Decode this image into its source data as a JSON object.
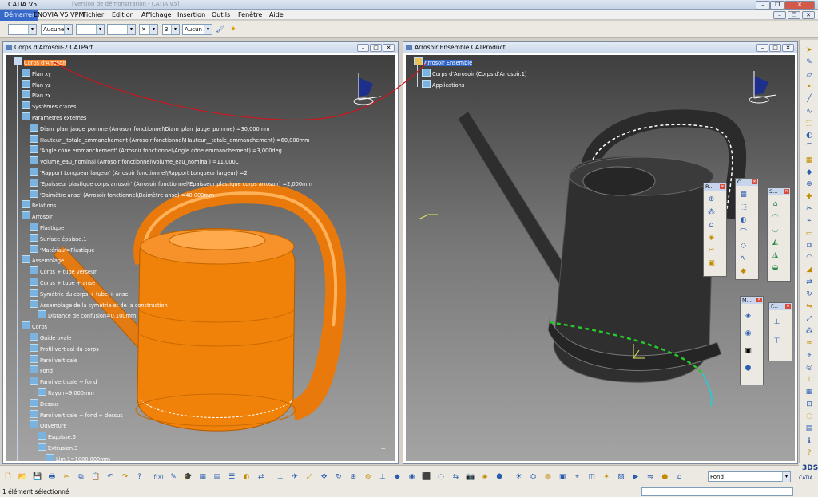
{
  "app_title": "CATIA V5",
  "title_ghost": "[Version de démonstration - CATIA V5]",
  "menu": {
    "start": "Démarrer",
    "items": [
      "ENOVIA V5 VPM",
      "Fichier",
      "Edition",
      "Affichage",
      "Insertion",
      "Outils",
      "Fenêtre",
      "Aide"
    ]
  },
  "toolbar": {
    "color_value": "",
    "transparency_value": "Aucune",
    "layer_value": "3",
    "layer_filter_value": "Aucun"
  },
  "window_left": {
    "title": "Corps d'Arrosoir-2.CATPart",
    "tree": [
      {
        "label": "Corps d'Arrosoir",
        "level": 0,
        "selected": true
      },
      {
        "label": "Plan xy",
        "level": 1
      },
      {
        "label": "Plan yz",
        "level": 1
      },
      {
        "label": "Plan zx",
        "level": 1
      },
      {
        "label": "Systèmes d'axes",
        "level": 1
      },
      {
        "label": "Paramètres externes",
        "level": 1
      },
      {
        "label": "Diam_plan_jauge_pomme (Arrosoir fonctionnel\\Diam_plan_jauge_pomme) =30,000mm",
        "level": 2
      },
      {
        "label": "Hauteur__totale_emmanchement (Arrosoir fonctionnel\\Hauteur__totale_emmanchement) =60,000mm",
        "level": 2
      },
      {
        "label": "'Angle cône emmanchement' (Arrosoir fonctionnel\\Angle cône emmanchement) =3,000deg",
        "level": 2
      },
      {
        "label": "Volume_eau_nominal (Arrosoir fonctionnel\\Volume_eau_nominal) =11,000L",
        "level": 2
      },
      {
        "label": "'Rapport Longueur largeur' (Arrosoir fonctionnel\\Rapport Longueur largeur) =2",
        "level": 2
      },
      {
        "label": "'Epaisseur plastique corps arrosoir' (Arrosoir fonctionnel\\Epaisseur plastique corps arrosoir) =2,000mm",
        "level": 2
      },
      {
        "label": "'Daimètre anse' (Arrosoir fonctionnel\\Daimètre anse) =40,000mm",
        "level": 2
      },
      {
        "label": "Relations",
        "level": 1
      },
      {
        "label": "Arrosoir",
        "level": 1
      },
      {
        "label": "Plastique",
        "level": 2
      },
      {
        "label": "Surface épaisse.1",
        "level": 2
      },
      {
        "label": "'Matériau'=Plastique",
        "level": 2
      },
      {
        "label": "Assemblage",
        "level": 1
      },
      {
        "label": "Corps + tube verseur",
        "level": 2
      },
      {
        "label": "Corps + tube + anse",
        "level": 2
      },
      {
        "label": "Symétrie du corps + tube + anse",
        "level": 2
      },
      {
        "label": "Assemblage de la symétrie et de la construction",
        "level": 2
      },
      {
        "label": "Distance de confusion=0,100mm",
        "level": 3
      },
      {
        "label": "Corps",
        "level": 1
      },
      {
        "label": "Guide ovale",
        "level": 2
      },
      {
        "label": "Profil vertical du corps",
        "level": 2
      },
      {
        "label": "Paroi verticale",
        "level": 2
      },
      {
        "label": "Fond",
        "level": 2
      },
      {
        "label": "Paroi verticale + fond",
        "level": 2
      },
      {
        "label": "Rayon=9,000mm",
        "level": 3
      },
      {
        "label": "Dessus",
        "level": 2
      },
      {
        "label": "Paroi verticale + fond + dessus",
        "level": 2
      },
      {
        "label": "Ouverture",
        "level": 2
      },
      {
        "label": "Esquisse.5",
        "level": 3
      },
      {
        "label": "Extrusion.3",
        "level": 3
      },
      {
        "label": "Lim 1=1000,000mm",
        "level": 4
      }
    ]
  },
  "window_right": {
    "title": "Arrosoir Ensemble.CATProduct",
    "tree": [
      {
        "label": "Arrosoir Ensemble",
        "level": 0,
        "selected": true
      },
      {
        "label": "Corps d'Arrosoir (Corps d'Arrosoir.1)",
        "level": 1
      },
      {
        "label": "Applications",
        "level": 1
      }
    ]
  },
  "palettes": [
    {
      "title": "R...",
      "icons": 6
    },
    {
      "title": "O...",
      "icons": 7
    },
    {
      "title": "S...",
      "icons": 6
    },
    {
      "title": "M...",
      "icons": 4
    },
    {
      "title": "F...",
      "icons": 2
    }
  ],
  "bottom_toolbar": {
    "render_mode": "Fond"
  },
  "status": {
    "text": "1 élément sélectionné"
  },
  "brand": {
    "logo": "3DS",
    "name": "CATIA"
  },
  "colors": {
    "orange_part": "#f0820a",
    "selection": "#f57d22",
    "dark_model": "#2d2d2d"
  }
}
